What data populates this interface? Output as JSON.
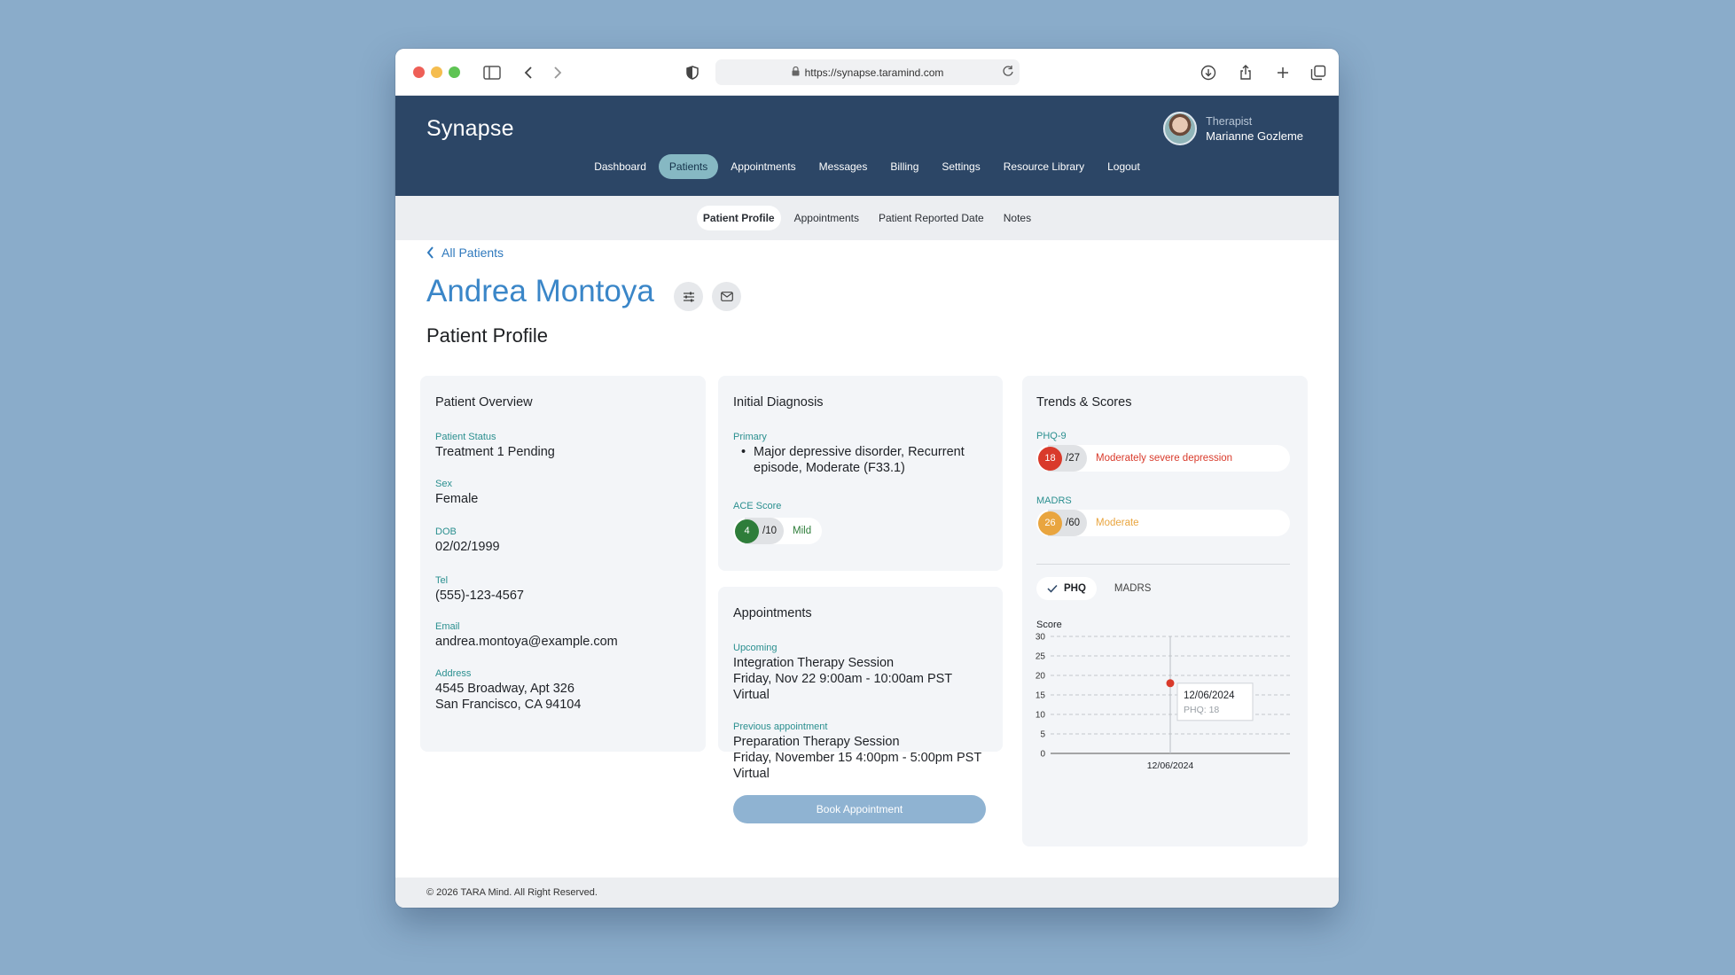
{
  "browser": {
    "url": "https://synapse.taramind.com",
    "icons": [
      "sidebar-icon",
      "back-icon",
      "forward-icon",
      "shield-icon",
      "lock-icon",
      "reload-icon",
      "download-icon",
      "share-icon",
      "new-tab-icon",
      "tabs-icon"
    ]
  },
  "app": {
    "brand": "Synapse",
    "user": {
      "role": "Therapist",
      "name": "Marianne Gozleme"
    },
    "nav": [
      "Dashboard",
      "Patients",
      "Appointments",
      "Messages",
      "Billing",
      "Settings",
      "Resource Library",
      "Logout"
    ],
    "nav_active": "Patients",
    "subnav": [
      "Patient Profile",
      "Appointments",
      "Patient Reported Date",
      "Notes"
    ],
    "subnav_active": "Patient Profile"
  },
  "page": {
    "back_label": "All Patients",
    "patient_name": "Andrea Montoya",
    "section_title": "Patient Profile"
  },
  "overview": {
    "title": "Patient Overview",
    "fields": [
      {
        "label": "Patient Status",
        "value": "Treatment 1 Pending"
      },
      {
        "label": "Sex",
        "value": "Female"
      },
      {
        "label": "DOB",
        "value": "02/02/1999"
      },
      {
        "label": "Tel",
        "value": "(555)-123-4567"
      },
      {
        "label": "Email",
        "value": "andrea.montoya@example.com"
      },
      {
        "label": "Address",
        "value": "4545 Broadway, Apt 326",
        "value2": "San Francisco, CA 94104"
      }
    ]
  },
  "diagnosis": {
    "title": "Initial Diagnosis",
    "primary_label": "Primary",
    "primary_line1": "Major depressive disorder, Recurrent",
    "primary_line2": "episode, Moderate (F33.1)",
    "ace_label": "ACE Score",
    "ace": {
      "score": "4",
      "outof": "/10",
      "severity": "Mild",
      "color": "#2e7d3a"
    }
  },
  "appointments": {
    "title": "Appointments",
    "upcoming_label": "Upcoming",
    "upcoming": {
      "name": "Integration Therapy Session",
      "time": "Friday, Nov 22 9:00am - 10:00am PST",
      "mode": "Virtual"
    },
    "previous_label": "Previous appointment",
    "previous": {
      "name": "Preparation Therapy Session",
      "time": "Friday, November 15 4:00pm - 5:00pm PST",
      "mode": "Virtual"
    },
    "book_label": "Book Appointment"
  },
  "trends": {
    "title": "Trends & Scores",
    "phq": {
      "label": "PHQ-9",
      "score": "18",
      "outof": "/27",
      "severity": "Moderately severe depression",
      "color": "#d93a2b"
    },
    "madrs": {
      "label": "MADRS",
      "score": "26",
      "outof": "/60",
      "severity": "Moderate",
      "color": "#e9a53f"
    },
    "tabs": [
      "PHQ",
      "MADRS"
    ],
    "tab_active": "PHQ"
  },
  "chart_data": {
    "type": "scatter",
    "ylabel": "Score",
    "ylim": [
      0,
      30
    ],
    "yticks": [
      0,
      5,
      10,
      15,
      20,
      25,
      30
    ],
    "grid": true,
    "categories": [
      "12/06/2024"
    ],
    "series": [
      {
        "name": "PHQ",
        "values": [
          18
        ],
        "color": "#d93a2b"
      }
    ],
    "tooltip": {
      "date": "12/06/2024",
      "text": "PHQ: 18"
    }
  },
  "footer": {
    "text": "© 2026 TARA Mind. All Right Reserved."
  }
}
